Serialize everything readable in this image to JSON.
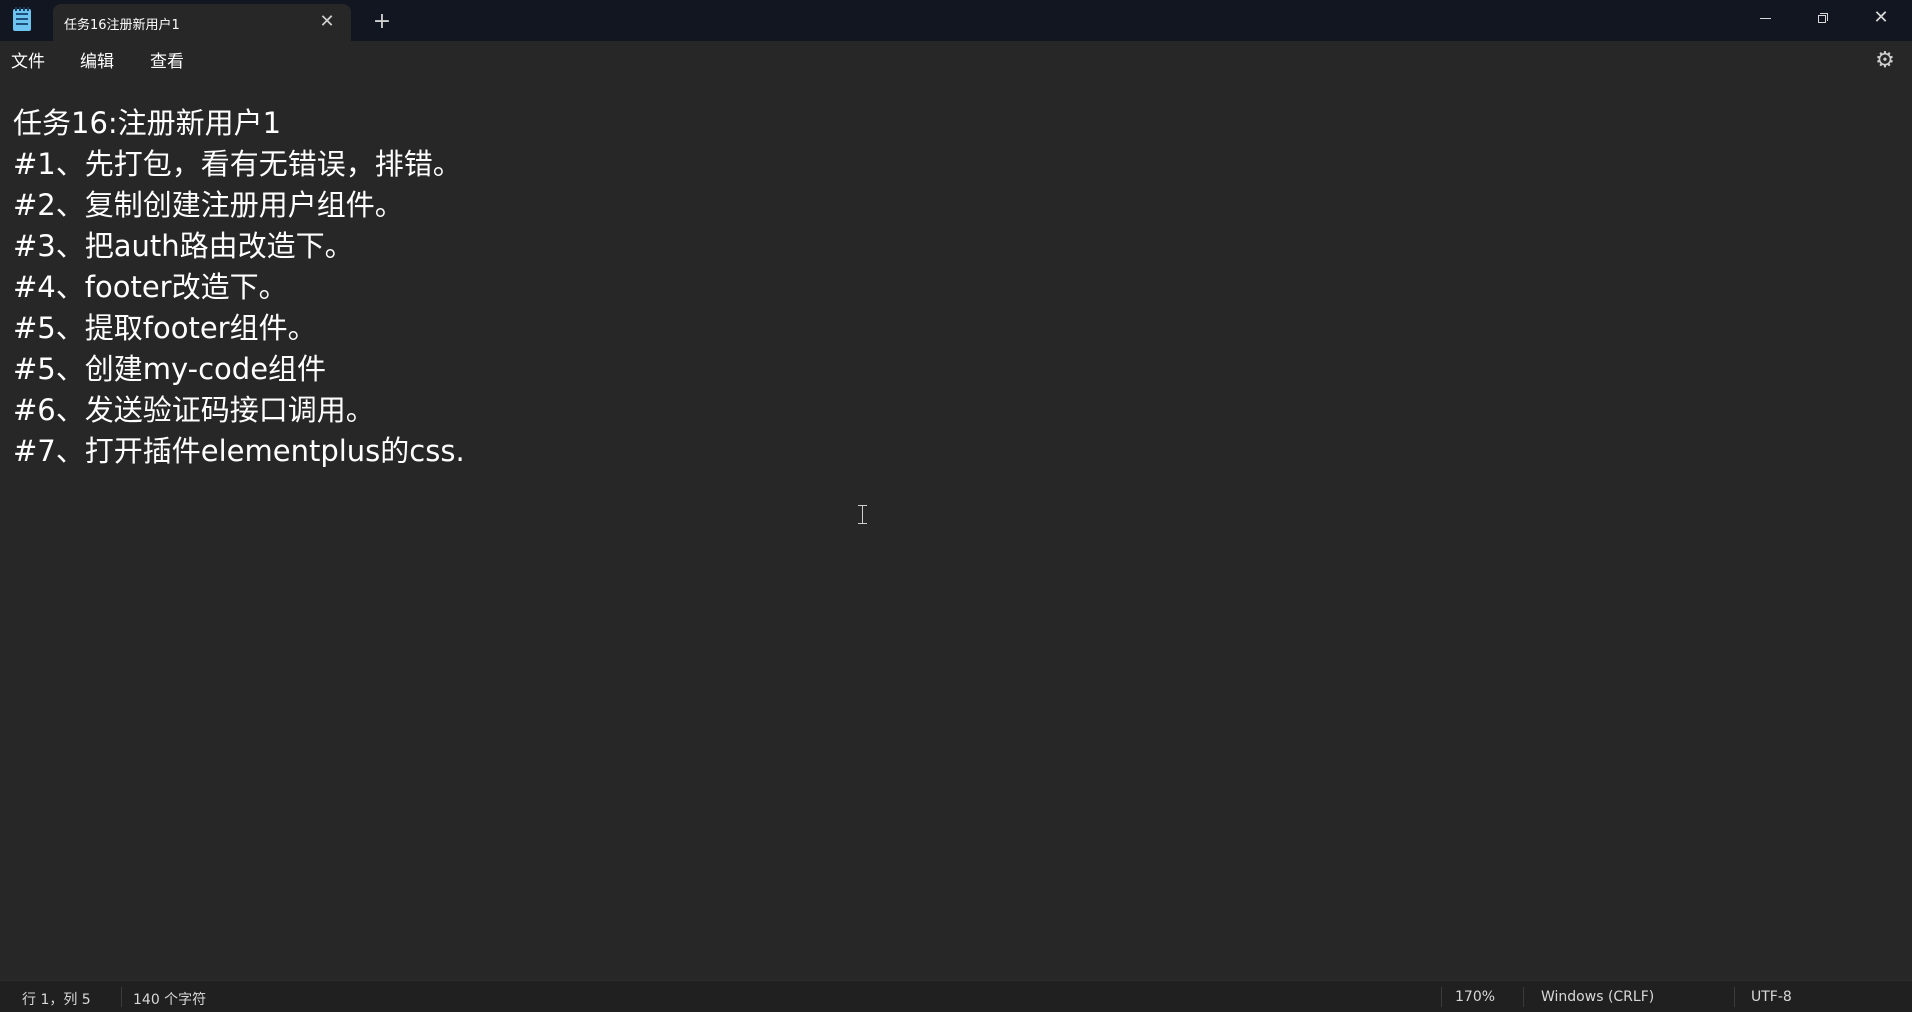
{
  "titlebar": {
    "app_icon": "notepad-icon",
    "tab_title": "任务16注册新用户1",
    "tab_close": "✕",
    "new_tab": "+",
    "minimize_icon": "minimize-icon",
    "maximize_icon": "restore-icon",
    "close_icon": "✕"
  },
  "menubar": {
    "file": "文件",
    "edit": "编辑",
    "view": "查看",
    "settings_icon": "⚙"
  },
  "editor": {
    "lines": [
      "任务16:注册新用户1",
      "#1、先打包，看有无错误，排错。",
      "#2、复制创建注册用户组件。",
      "#3、把auth路由改造下。",
      "#4、footer改造下。",
      "#5、提取footer组件。",
      "#5、创建my-code组件",
      "#6、发送验证码接口调用。",
      "#7、打开插件elementplus的css."
    ]
  },
  "statusbar": {
    "position": "行 1，列 5",
    "char_count": "140 个字符",
    "zoom": "170%",
    "line_ending": "Windows (CRLF)",
    "encoding": "UTF-8"
  },
  "colors": {
    "titlebar_bg": "#111621",
    "editor_bg": "#272727",
    "statusbar_bg": "#202020",
    "text": "#ffffff"
  }
}
